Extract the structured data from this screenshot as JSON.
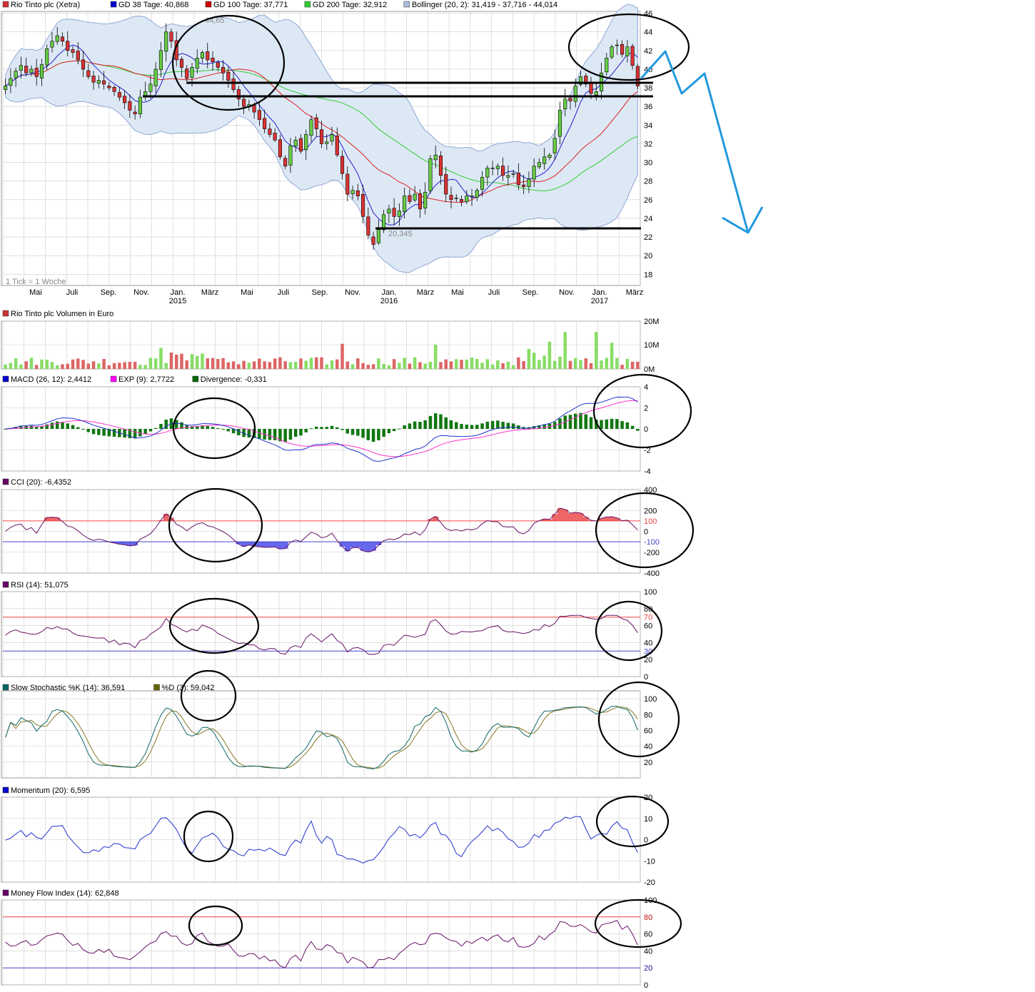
{
  "panels": {
    "price": {
      "legend": [
        {
          "label": "Rio Tinto plc (Xetra)",
          "color": "#cc3333"
        },
        {
          "label": "GD 38 Tage: 40,868",
          "color": "#0000cc"
        },
        {
          "label": "GD 100 Tage: 37,771",
          "color": "#cc0000"
        },
        {
          "label": "GD 200 Tage: 32,912",
          "color": "#33cc33"
        },
        {
          "label": "Bollinger (20, 2): 31,419 - 37,716 - 44,014",
          "color": "#aabbdd"
        }
      ],
      "yticks": [
        "46",
        "44",
        "42",
        "40",
        "38",
        "36",
        "34",
        "32",
        "30",
        "28",
        "26",
        "24",
        "22",
        "20",
        "18"
      ],
      "high_label": "44,65",
      "low_label": "20,345",
      "tick_note": "1 Tick = 1 Woche",
      "xticks": [
        "Mai",
        "Juli",
        "Sep.",
        "Nov.",
        "Jan.",
        "März",
        "Mai",
        "Juli",
        "Sep.",
        "Nov.",
        "Jan.",
        "März",
        "Mai",
        "Juli",
        "Sep.",
        "Nov.",
        "Jan.",
        "März"
      ],
      "years": [
        "2015",
        "2016",
        "2017"
      ]
    },
    "volume": {
      "legend": [
        {
          "label": "Rio Tinto plc Volumen in Euro",
          "color": "#cc3333"
        }
      ],
      "yticks": [
        "20M",
        "10M",
        "0M"
      ]
    },
    "macd": {
      "legend": [
        {
          "label": "MACD (26, 12): 2,4412",
          "color": "#0000cc"
        },
        {
          "label": "EXP (9): 2,7722",
          "color": "#ff00ff"
        },
        {
          "label": "Divergence: -0,331",
          "color": "#006600"
        }
      ],
      "yticks": [
        "4",
        "2",
        "0",
        "-2",
        "-4"
      ]
    },
    "cci": {
      "legend": [
        {
          "label": "CCI (20): -6,4352",
          "color": "#660066"
        }
      ],
      "yticks": [
        "400",
        "200",
        "0",
        "-200",
        "-400"
      ],
      "level_upper": "100",
      "level_lower": "-100"
    },
    "rsi": {
      "legend": [
        {
          "label": "RSI (14): 51,075",
          "color": "#660066"
        }
      ],
      "yticks": [
        "100",
        "80",
        "60",
        "40",
        "20",
        "0"
      ],
      "level_upper": "70",
      "level_lower": "30"
    },
    "stoch": {
      "legend": [
        {
          "label": "Slow Stochastic %K (14): 36,591",
          "color": "#006666"
        },
        {
          "label": "%D (3): 59,042",
          "color": "#666600"
        }
      ],
      "yticks": [
        "100",
        "80",
        "60",
        "40",
        "20"
      ]
    },
    "momentum": {
      "legend": [
        {
          "label": "Momentum (20): 6,595",
          "color": "#0000cc"
        }
      ],
      "yticks": [
        "20",
        "10",
        "0",
        "-10",
        "-20"
      ]
    },
    "mfi": {
      "legend": [
        {
          "label": "Money Flow Index (14): 62,848",
          "color": "#660066"
        }
      ],
      "yticks": [
        "100",
        "80",
        "60",
        "40",
        "20",
        "0"
      ],
      "level_upper": "80",
      "level_lower": "20"
    }
  },
  "colors": {
    "up": "#66cc44",
    "down": "#dd3333",
    "grid": "#cccccc",
    "annotation_arrow": "#2299dd",
    "bollinger_fill": "#dde8f5"
  },
  "chart_data": {
    "type": "candlestick",
    "instrument": "Rio Tinto plc (Xetra)",
    "interval": "weekly",
    "price_weekly_close": [
      38.2,
      39.0,
      39.8,
      40.4,
      39.6,
      40.0,
      39.2,
      40.5,
      42.2,
      43.0,
      43.6,
      43.0,
      42.0,
      41.8,
      41.0,
      40.0,
      39.2,
      38.6,
      38.8,
      38.4,
      38.0,
      37.6,
      37.0,
      36.4,
      35.6,
      35.2,
      37.0,
      37.6,
      38.4,
      40.0,
      42.0,
      44.0,
      43.0,
      41.0,
      40.2,
      39.0,
      40.2,
      41.2,
      41.8,
      41.0,
      40.8,
      40.2,
      39.6,
      38.8,
      37.8,
      36.8,
      36.0,
      36.2,
      35.4,
      34.6,
      33.6,
      33.0,
      32.4,
      30.6,
      29.6,
      31.8,
      32.4,
      31.2,
      33.0,
      34.6,
      33.6,
      32.0,
      32.2,
      33.0,
      30.8,
      28.8,
      26.6,
      27.0,
      26.4,
      24.2,
      22.2,
      21.2,
      22.8,
      24.4,
      25.0,
      24.2,
      24.8,
      26.4,
      25.8,
      26.6,
      25.0,
      26.8,
      30.4,
      30.8,
      28.6,
      26.6,
      26.0,
      26.2,
      25.8,
      26.4,
      26.4,
      27.0,
      28.4,
      29.4,
      29.4,
      29.6,
      28.6,
      28.6,
      28.8,
      27.6,
      27.4,
      28.2,
      29.6,
      30.0,
      30.6,
      30.8,
      32.6,
      35.6,
      36.8,
      36.6,
      38.2,
      39.2,
      38.4,
      37.4,
      37.6,
      39.6,
      41.2,
      42.4,
      42.6,
      41.6,
      42.4,
      40.4,
      38.2
    ],
    "bollinger": {
      "lower": 31.419,
      "middle": 37.716,
      "upper": 44.014
    },
    "gd38": 40.868,
    "gd100": 37.771,
    "gd200": 32.912,
    "high": 44.65,
    "low": 20.345,
    "y_range": [
      16.8,
      46.2
    ],
    "indicators": {
      "volume_last_M": 8,
      "macd": 2.4412,
      "macd_signal": 2.7722,
      "macd_divergence": -0.331,
      "cci": -6.4352,
      "rsi": 51.075,
      "stoch_k": 36.591,
      "stoch_d": 59.042,
      "momentum": 6.595,
      "mfi": 62.848
    }
  }
}
